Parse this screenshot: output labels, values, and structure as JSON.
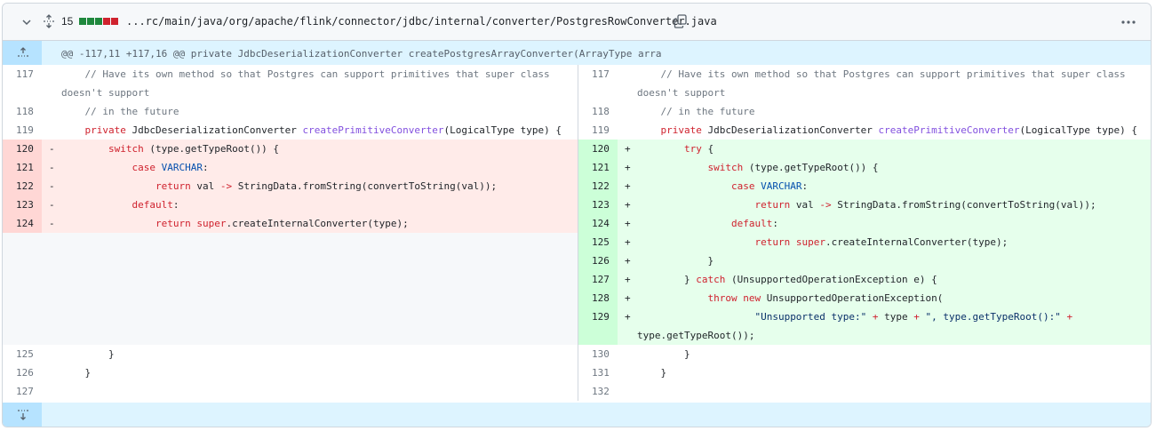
{
  "file_header": {
    "change_count": "15",
    "diffstat_colors": [
      "#1f883d",
      "#1f883d",
      "#1f883d",
      "#cf222e",
      "#cf222e"
    ],
    "path": "...rc/main/java/org/apache/flink/connector/jdbc/internal/converter/PostgresRowConverter.java",
    "icons": {
      "collapse": "chevron-down-icon",
      "expand": "unfold-icon",
      "copy": "copy-icon",
      "more": "kebab-horizontal-icon"
    }
  },
  "hunk_header": "@@ -117,11 +117,16 @@ private JdbcDeserializationConverter createPostgresArrayConverter(ArrayType arra",
  "left": [
    {
      "num": "117",
      "mark": "",
      "code": "    // Have its own method so that Postgres can support primitives that super class doesn't support"
    },
    {
      "num": "118",
      "mark": "",
      "code": "    // in the future"
    },
    {
      "num": "119",
      "mark": "",
      "code": "    private JdbcDeserializationConverter createPrimitiveConverter(LogicalType type) {"
    },
    {
      "num": "120",
      "mark": "-",
      "code": "        switch (type.getTypeRoot()) {"
    },
    {
      "num": "121",
      "mark": "-",
      "code": "            case VARCHAR:"
    },
    {
      "num": "122",
      "mark": "-",
      "code": "                return val -> StringData.fromString(convertToString(val));"
    },
    {
      "num": "123",
      "mark": "-",
      "code": "            default:"
    },
    {
      "num": "124",
      "mark": "-",
      "code": "                return super.createInternalConverter(type);"
    },
    {
      "num": "125",
      "mark": "",
      "code": "        }"
    },
    {
      "num": "126",
      "mark": "",
      "code": "    }"
    },
    {
      "num": "127",
      "mark": "",
      "code": ""
    }
  ],
  "right": [
    {
      "num": "117",
      "mark": "",
      "code": "    // Have its own method so that Postgres can support primitives that super class doesn't support"
    },
    {
      "num": "118",
      "mark": "",
      "code": "    // in the future"
    },
    {
      "num": "119",
      "mark": "",
      "code": "    private JdbcDeserializationConverter createPrimitiveConverter(LogicalType type) {"
    },
    {
      "num": "120",
      "mark": "+",
      "code": "        try {"
    },
    {
      "num": "121",
      "mark": "+",
      "code": "            switch (type.getTypeRoot()) {"
    },
    {
      "num": "122",
      "mark": "+",
      "code": "                case VARCHAR:"
    },
    {
      "num": "123",
      "mark": "+",
      "code": "                    return val -> StringData.fromString(convertToString(val));"
    },
    {
      "num": "124",
      "mark": "+",
      "code": "                default:"
    },
    {
      "num": "125",
      "mark": "+",
      "code": "                    return super.createInternalConverter(type);"
    },
    {
      "num": "126",
      "mark": "+",
      "code": "            }"
    },
    {
      "num": "127",
      "mark": "+",
      "code": "        } catch (UnsupportedOperationException e) {"
    },
    {
      "num": "128",
      "mark": "+",
      "code": "            throw new UnsupportedOperationException("
    },
    {
      "num": "129",
      "mark": "+",
      "code": "                    \"Unsupported type:\" + type + \", type.getTypeRoot():\" + type.getTypeRoot());"
    },
    {
      "num": "130",
      "mark": "",
      "code": "        }"
    },
    {
      "num": "131",
      "mark": "",
      "code": "    }"
    },
    {
      "num": "132",
      "mark": "",
      "code": ""
    }
  ]
}
